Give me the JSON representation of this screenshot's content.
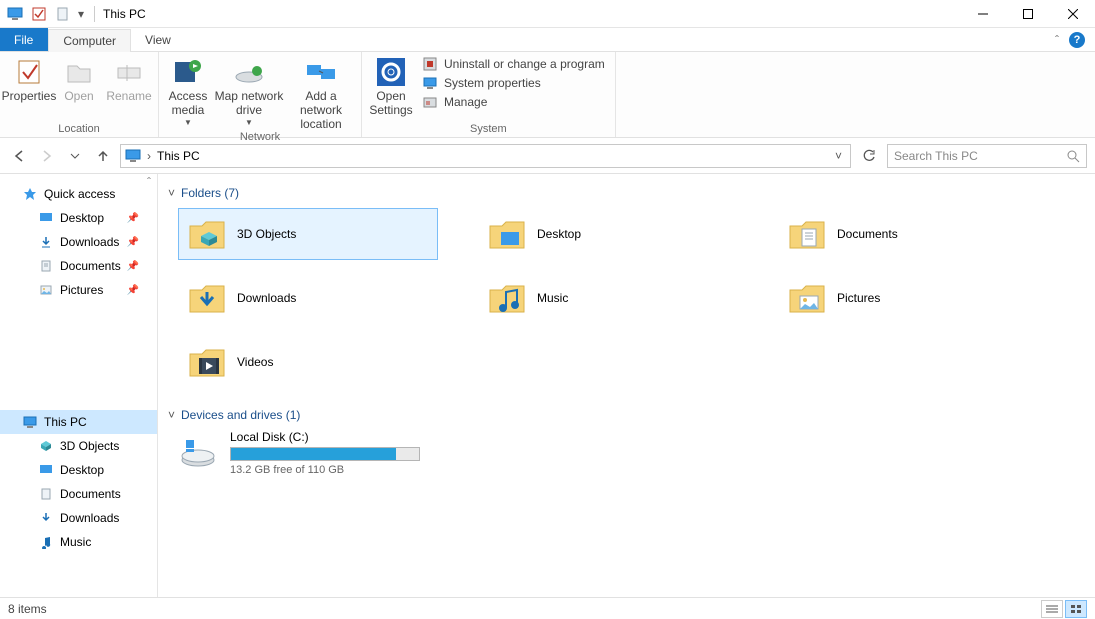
{
  "title": "This PC",
  "tabs": {
    "file": "File",
    "computer": "Computer",
    "view": "View"
  },
  "ribbon": {
    "location": {
      "label": "Location",
      "properties": "Properties",
      "open": "Open",
      "rename": "Rename"
    },
    "network": {
      "label": "Network",
      "access_media": "Access media",
      "map_drive": "Map network drive",
      "add_location": "Add a network location"
    },
    "system": {
      "label": "System",
      "open_settings": "Open Settings",
      "uninstall": "Uninstall or change a program",
      "sys_props": "System properties",
      "manage": "Manage"
    }
  },
  "address": {
    "location": "This PC"
  },
  "search": {
    "placeholder": "Search This PC"
  },
  "sidebar": {
    "quick_access": "Quick access",
    "qa_items": [
      {
        "label": "Desktop",
        "pinned": true
      },
      {
        "label": "Downloads",
        "pinned": true
      },
      {
        "label": "Documents",
        "pinned": true
      },
      {
        "label": "Pictures",
        "pinned": true
      }
    ],
    "this_pc": "This PC",
    "pc_items": [
      {
        "label": "3D Objects"
      },
      {
        "label": "Desktop"
      },
      {
        "label": "Documents"
      },
      {
        "label": "Downloads"
      },
      {
        "label": "Music"
      }
    ]
  },
  "groups": {
    "folders": {
      "header": "Folders (7)",
      "items": [
        "3D Objects",
        "Desktop",
        "Documents",
        "Downloads",
        "Music",
        "Pictures",
        "Videos"
      ]
    },
    "drives": {
      "header": "Devices and drives (1)",
      "items": [
        {
          "label": "Local Disk (C:)",
          "free_text": "13.2 GB free of 110 GB",
          "fill_pct": 88
        }
      ]
    }
  },
  "status": {
    "items": "8 items"
  }
}
